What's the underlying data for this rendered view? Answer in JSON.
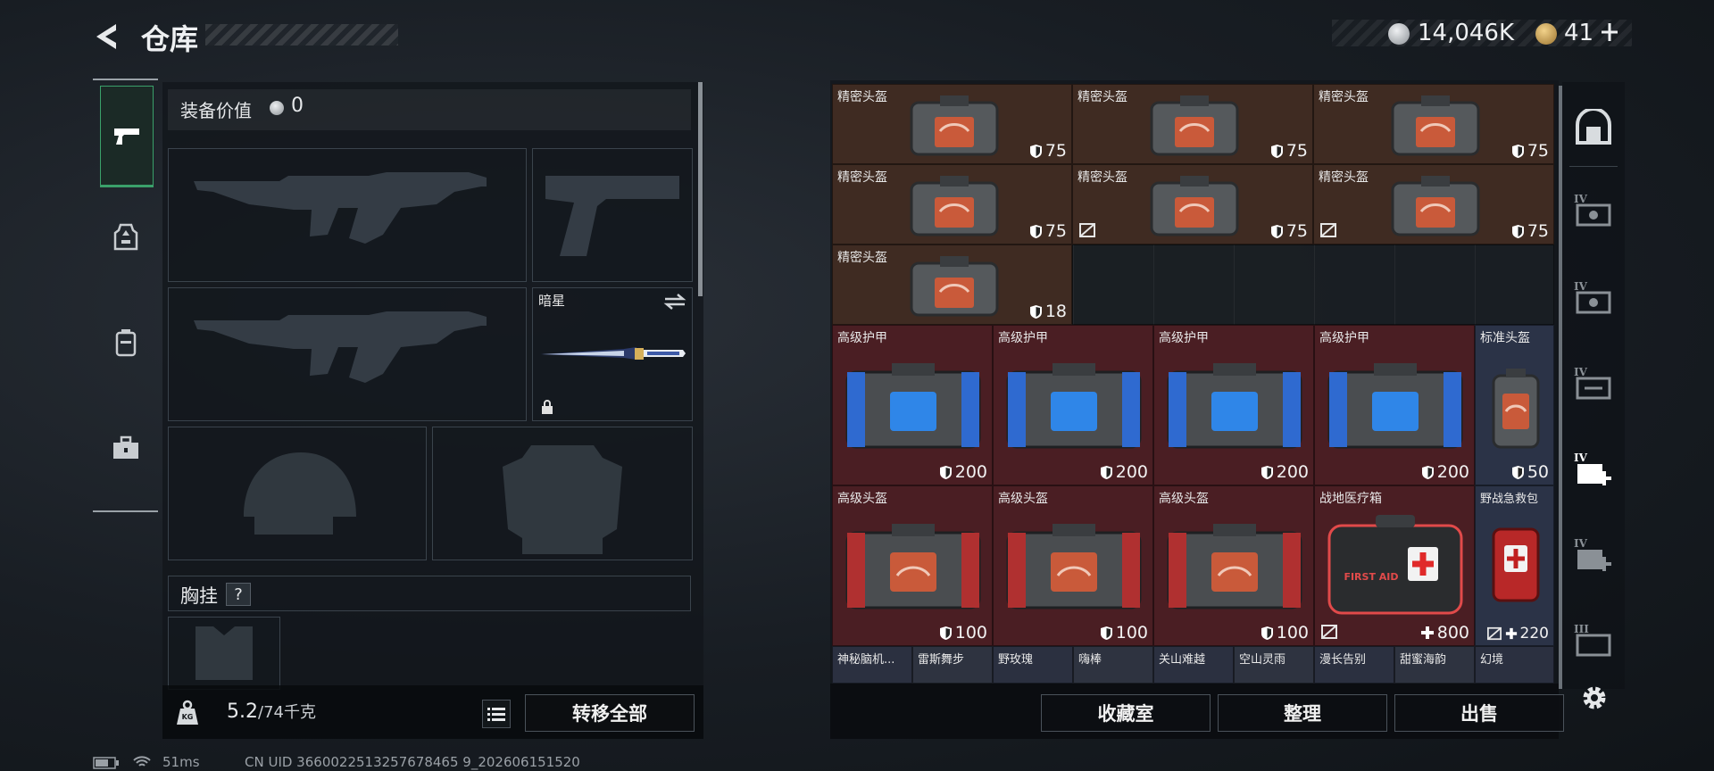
{
  "header": {
    "title": "仓库",
    "currency1": "14,046K",
    "currency2": "41"
  },
  "left": {
    "equip_value_label": "装备价值",
    "equip_value": "0",
    "melee_name": "暗星",
    "chest_rig_label": "胸挂",
    "help_mark": "?",
    "weight_current": "5.2",
    "weight_max": "/74千克",
    "weight_badge": "KG",
    "transfer_all": "转移全部"
  },
  "grid": {
    "r1": [
      {
        "name": "精密头盔",
        "value": "75"
      },
      {
        "name": "精密头盔",
        "value": "75"
      },
      {
        "name": "精密头盔",
        "value": "75"
      }
    ],
    "r2": [
      {
        "name": "精密头盔",
        "value": "75"
      },
      {
        "name": "精密头盔",
        "value": "75"
      },
      {
        "name": "精密头盔",
        "value": "75"
      }
    ],
    "r3": [
      {
        "name": "精密头盔",
        "value": "18"
      }
    ],
    "r4": [
      {
        "name": "高级护甲",
        "value": "200"
      },
      {
        "name": "高级护甲",
        "value": "200"
      },
      {
        "name": "高级护甲",
        "value": "200"
      },
      {
        "name": "高级护甲",
        "value": "200"
      },
      {
        "name": "标准头盔",
        "value": "50"
      }
    ],
    "r5": [
      {
        "name": "高级头盔",
        "value": "100"
      },
      {
        "name": "高级头盔",
        "value": "100"
      },
      {
        "name": "高级头盔",
        "value": "100"
      },
      {
        "name": "战地医疗箱",
        "value": "800"
      },
      {
        "name": "野战急救包",
        "value": "220"
      }
    ],
    "r6": [
      "神秘脑机...",
      "雷斯舞步",
      "野玫瑰",
      "嗨棒",
      "关山难越",
      "空山灵雨",
      "漫长告别",
      "甜蜜海韵",
      "幻境"
    ],
    "kit_text": "FIRST AID"
  },
  "bottom": {
    "collection": "收藏室",
    "sort": "整理",
    "sell": "出售"
  },
  "right_tabs": [
    "IV",
    "IV",
    "IV",
    "IV",
    "IV",
    "III"
  ],
  "status": {
    "ping": "51ms",
    "uid": "CN UID 3660022513257678465 9_202606151520"
  },
  "colors": {
    "brown": "#3f2b22",
    "red": "#4a1e23",
    "blue": "#2b3347",
    "accent_green": "#3aa06a"
  }
}
